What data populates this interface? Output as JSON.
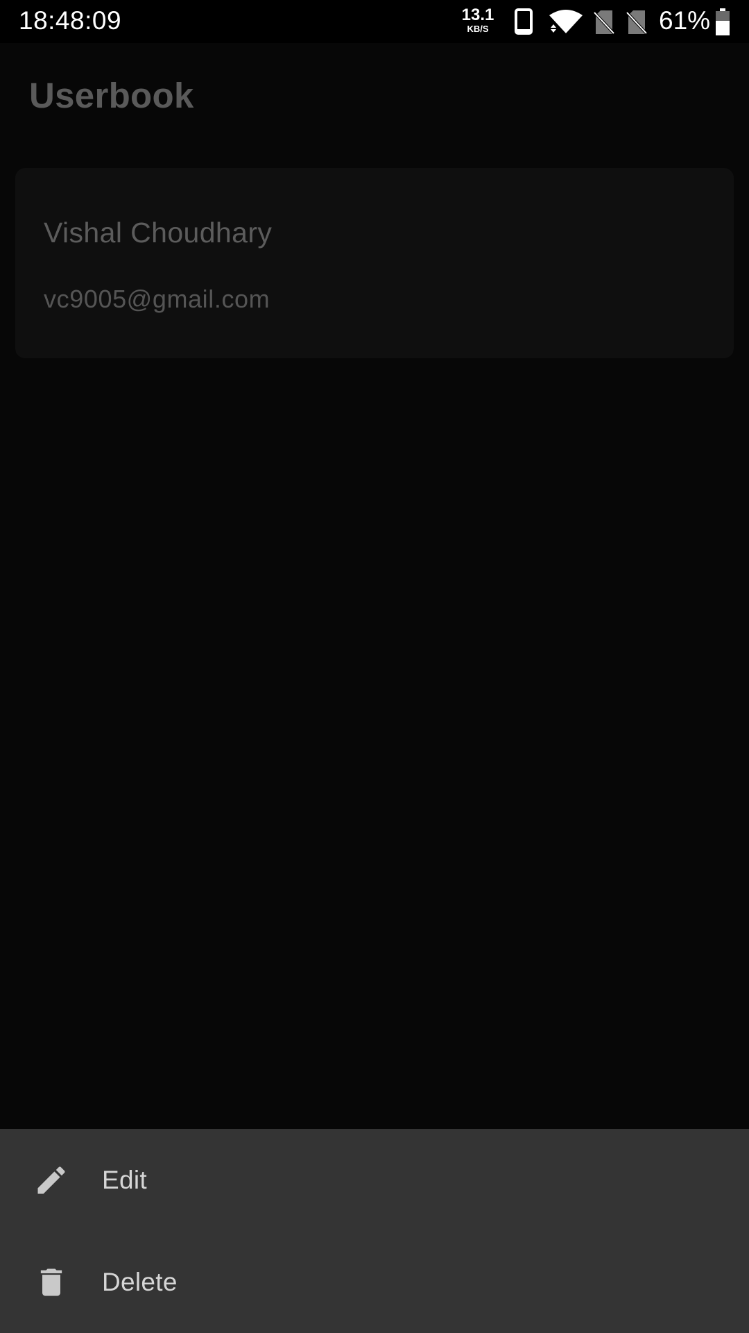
{
  "status_bar": {
    "time": "18:48:09",
    "net_speed_value": "13.1",
    "net_speed_unit": "KB/S",
    "battery_percent": "61%",
    "battery_level": 0.61,
    "icons": [
      "phone-icon",
      "wifi-icon",
      "no-sim-icon",
      "no-sim-icon",
      "battery-icon"
    ]
  },
  "app": {
    "title": "Userbook"
  },
  "user_card": {
    "name": "Vishal Choudhary",
    "email": "vc9005@gmail.com"
  },
  "bottom_sheet": {
    "items": [
      {
        "label": "Edit",
        "icon": "pencil-icon"
      },
      {
        "label": "Delete",
        "icon": "trash-icon"
      }
    ]
  },
  "colors": {
    "background": "#070707",
    "card": "#0f0f0f",
    "sheet": "#343434",
    "sheet_text": "#d6d6d6",
    "dimmed_text": "#5a5a5a"
  }
}
